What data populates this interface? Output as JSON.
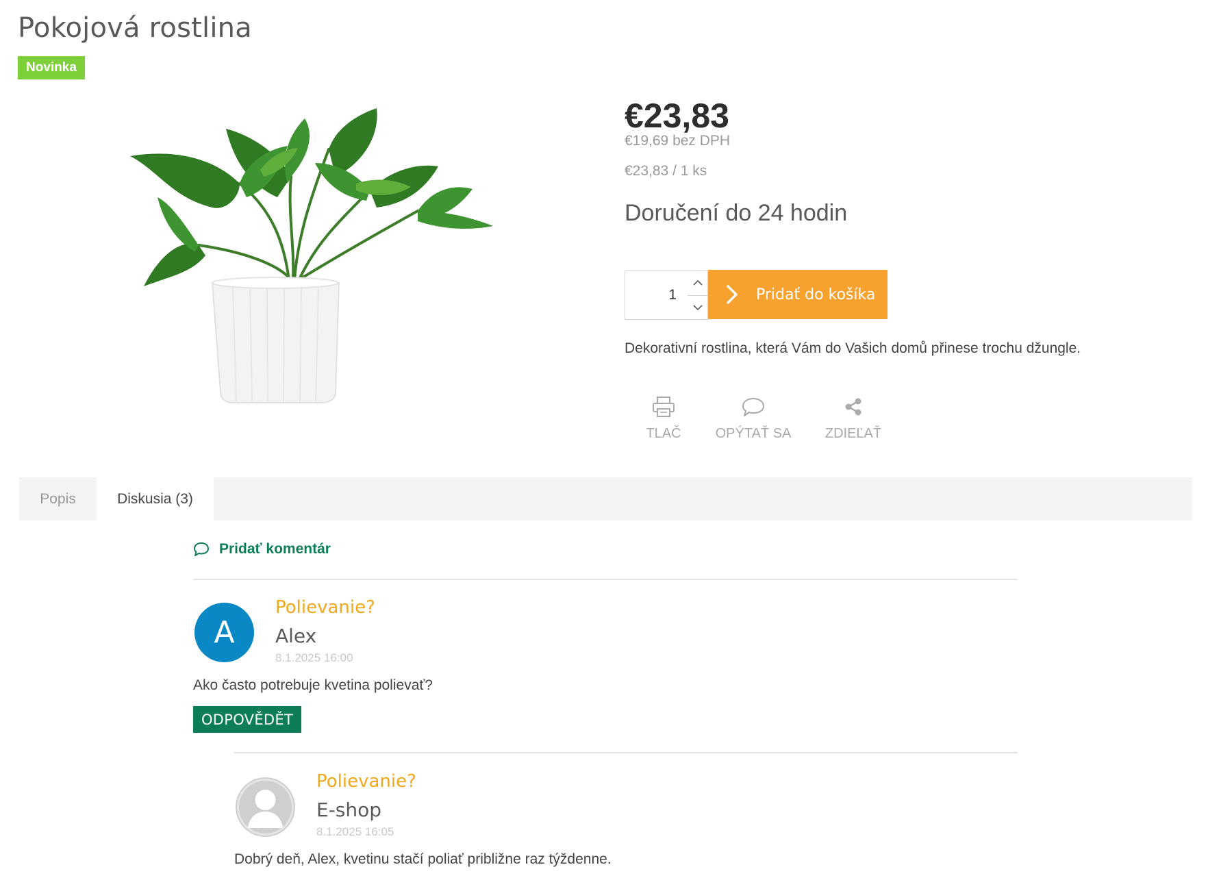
{
  "product": {
    "title": "Pokojová rostlina",
    "badge": "Novinka",
    "price": "€23,83",
    "price_without_vat": "€19,69 bez DPH",
    "unit_price": "€23,83 / 1 ks",
    "delivery": "Doručení do 24 hodin",
    "quantity": "1",
    "add_to_cart_label": "Pridať do košíka",
    "short_description": "Dekorativní rostlina, která Vám do Vašich domů přinese trochu džungle."
  },
  "actions": [
    {
      "label": "TLAČ",
      "icon": "print-icon"
    },
    {
      "label": "OPÝTAŤ SA",
      "icon": "speech-bubble-icon"
    },
    {
      "label": "ZDIEĽAŤ",
      "icon": "share-icon"
    }
  ],
  "tabs": [
    {
      "label": "Popis",
      "active": false
    },
    {
      "label": "Diskusia (3)",
      "active": true
    }
  ],
  "discussion": {
    "add_comment_label": "Pridať komentár",
    "reply_label": "ODPOVĚDĚT",
    "comments": [
      {
        "avatar_letter": "A",
        "subject": "Polievanie?",
        "author": "Alex",
        "date": "8.1.2025 16:00",
        "text": "Ako často potrebuje kvetina polievať?"
      },
      {
        "avatar_letter": "",
        "subject": "Polievanie?",
        "author": "E-shop",
        "date": "8.1.2025 16:05",
        "text": "Dobrý deň, Alex, kvetinu stačí poliať približne raz týždenne."
      }
    ]
  },
  "colors": {
    "badge": "#7ed03b",
    "cart_button": "#f7a12e",
    "accent_green": "#0c7d57",
    "subject": "#f0a81c",
    "avatar_blue": "#0a87c5"
  }
}
